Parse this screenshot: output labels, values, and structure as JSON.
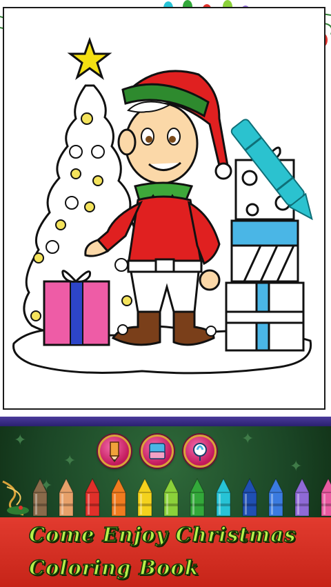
{
  "banner": {
    "line1": "Come Enjoy Christmas",
    "line2": "Coloring Book"
  },
  "tools": [
    {
      "name": "pencil-tool-button",
      "icon": "pencil-icon"
    },
    {
      "name": "eraser-tool-button",
      "icon": "eraser-icon"
    },
    {
      "name": "fill-tool-button",
      "icon": "paint-bucket-icon"
    }
  ],
  "crayons": {
    "colors": [
      "#8a6a4a",
      "#e7a16a",
      "#e0302a",
      "#f07b1f",
      "#f4d21d",
      "#8bd13a",
      "#33a83a",
      "#27c3d6",
      "#1f4fb3",
      "#3b7be0",
      "#8f6ad6",
      "#e85aa0"
    ]
  },
  "colors": {
    "accent": "#c62418",
    "banner_text": "#b7f04a",
    "panel": "#1b4626",
    "divider": "#2a2070"
  }
}
